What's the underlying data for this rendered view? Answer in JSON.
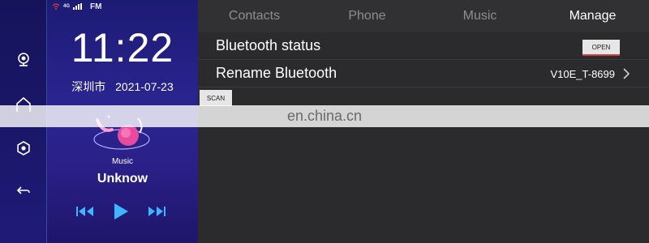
{
  "status": {
    "signal_label": "4G",
    "radio_label": "FM"
  },
  "clock": {
    "time": "11:22",
    "location": "深圳市",
    "date": "2021-07-23"
  },
  "left_rail": {
    "icons": [
      "camera-icon",
      "home-icon",
      "settings-icon",
      "back-icon"
    ]
  },
  "music": {
    "label": "Music",
    "track": "Unknow"
  },
  "tabs": [
    {
      "label": "Contacts",
      "active": false
    },
    {
      "label": "Phone",
      "active": false
    },
    {
      "label": "Music",
      "active": false
    },
    {
      "label": "Manage",
      "active": true
    }
  ],
  "settings": {
    "bt_status_label": "Bluetooth status",
    "open_label": "OPEN",
    "rename_label": "Rename Bluetooth",
    "device_name": "V10E_T-8699",
    "scan_label": "SCAN"
  },
  "watermark": {
    "text": "en.china.cn"
  },
  "colors": {
    "accent_red": "#d33a3a",
    "panel_purple": "#2b2592",
    "active_tab": "#ffffff",
    "inactive_tab": "#8e8e92"
  }
}
